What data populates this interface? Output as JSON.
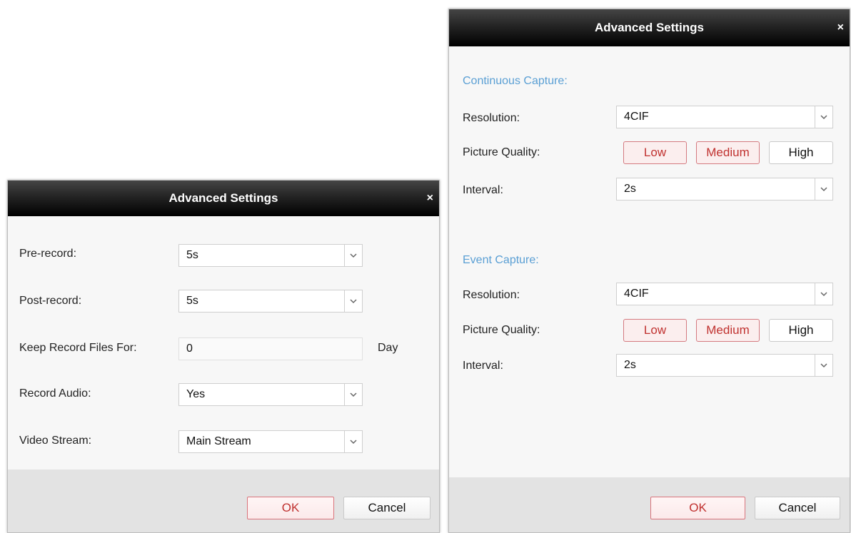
{
  "left_dialog": {
    "title": "Advanced Settings",
    "close": "×",
    "pre_record": {
      "label": "Pre-record:",
      "value": "5s"
    },
    "post_record": {
      "label": "Post-record:",
      "value": "5s"
    },
    "keep_files": {
      "label": "Keep Record Files For:",
      "value": "0",
      "unit": "Day"
    },
    "record_audio": {
      "label": "Record Audio:",
      "value": "Yes"
    },
    "video_stream": {
      "label": "Video Stream:",
      "value": "Main Stream"
    },
    "ok_label": "OK",
    "cancel_label": "Cancel"
  },
  "right_dialog": {
    "title": "Advanced Settings",
    "close": "×",
    "continuous": {
      "heading": "Continuous Capture:",
      "resolution": {
        "label": "Resolution:",
        "value": "4CIF"
      },
      "quality": {
        "label": "Picture Quality:",
        "options": [
          "Low",
          "Medium",
          "High"
        ],
        "selected": [
          "Low",
          "Medium"
        ]
      },
      "interval": {
        "label": "Interval:",
        "value": "2s"
      }
    },
    "event": {
      "heading": "Event Capture:",
      "resolution": {
        "label": "Resolution:",
        "value": "4CIF"
      },
      "quality": {
        "label": "Picture Quality:",
        "options": [
          "Low",
          "Medium",
          "High"
        ],
        "selected": [
          "Low",
          "Medium"
        ]
      },
      "interval": {
        "label": "Interval:",
        "value": "2s"
      }
    },
    "ok_label": "OK",
    "cancel_label": "Cancel"
  },
  "colors": {
    "section_heading": "#5a9fd4",
    "primary_border": "#d9737b",
    "primary_text": "#c0312f"
  }
}
